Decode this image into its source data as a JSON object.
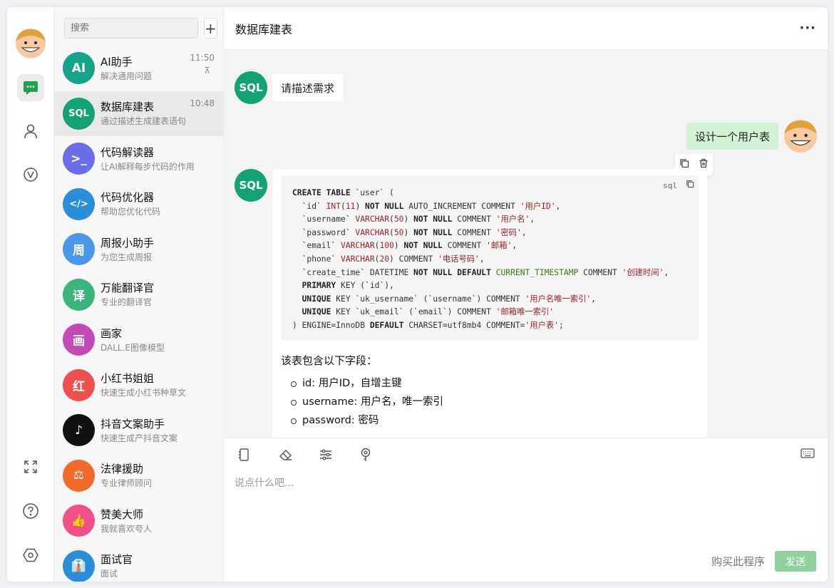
{
  "sidebar_rail": {
    "top_icons": [
      "chat-icon",
      "user-icon",
      "v-badge-icon"
    ],
    "bottom_icons": [
      "fullscreen-icon",
      "help-icon",
      "settings-icon"
    ]
  },
  "list": {
    "search_placeholder": "搜索",
    "add_label": "+",
    "conversations": [
      {
        "name": "AI助手",
        "desc": "解决通用问题",
        "time": "11:50",
        "pin": "⊼",
        "avatar_text": "AI",
        "color": "#15a38a"
      },
      {
        "name": "数据库建表",
        "desc": "通过描述生成建表语句",
        "time": "10:48",
        "avatar_text": "SQL",
        "color": "#13a274"
      },
      {
        "name": "代码解读器",
        "desc": "让AI解释每步代码的作用",
        "avatar_text": ">_",
        "color": "#6a6fe8"
      },
      {
        "name": "代码优化器",
        "desc": "帮助您优化代码",
        "avatar_text": "</>",
        "color": "#2a8fd8"
      },
      {
        "name": "周报小助手",
        "desc": "为您生成周报",
        "avatar_text": "周",
        "color": "#4a98e8"
      },
      {
        "name": "万能翻译官",
        "desc": "专业的翻译官",
        "avatar_text": "译",
        "color": "#3cb57a"
      },
      {
        "name": "画家",
        "desc": "DALL.E图像模型",
        "avatar_text": "画",
        "color": "#c44ab8"
      },
      {
        "name": "小红书姐姐",
        "desc": "快速生成小红书种草文",
        "avatar_text": "红",
        "color": "#ee5050"
      },
      {
        "name": "抖音文案助手",
        "desc": "快速生成产抖音文案",
        "avatar_text": "♪",
        "color": "#111111"
      },
      {
        "name": "法律援助",
        "desc": "专业律师顾问",
        "avatar_text": "⚖",
        "color": "#f06a2a"
      },
      {
        "name": "赞美大师",
        "desc": "我就喜欢夸人",
        "avatar_text": "👍",
        "color": "#f0508a"
      },
      {
        "name": "面试官",
        "desc": "面试",
        "avatar_text": "👔",
        "color": "#2a8fd8"
      }
    ]
  },
  "chat": {
    "title": "数据库建表",
    "more": "···",
    "bot_avatar": "SQL",
    "greeting": "请描述需求",
    "user_message": "设计一个用户表",
    "code_lang": "sql",
    "summary": "该表包含以下字段：",
    "fields": [
      "id: 用户ID，自增主键",
      "username: 用户名，唯一索引",
      "password: 密码"
    ]
  },
  "composer": {
    "placeholder": "说点什么吧...",
    "buy_label": "购买此程序",
    "send_label": "发送"
  },
  "colors": {
    "accent_green": "#13a274",
    "user_bubble": "#d2f2d4",
    "send_button": "#8fd09b"
  }
}
